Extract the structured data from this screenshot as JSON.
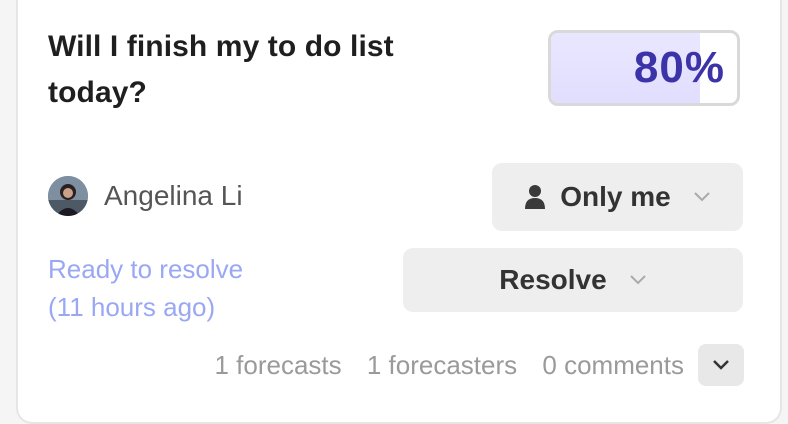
{
  "market": {
    "question": "Will I finish my to do list today?",
    "probability_label": "80%",
    "probability_fraction": 0.8
  },
  "author": {
    "name": "Angelina Li"
  },
  "visibility": {
    "label": "Only me"
  },
  "resolve": {
    "label": "Resolve"
  },
  "status": {
    "line1": "Ready to resolve",
    "line2": "(11 hours ago)"
  },
  "stats": {
    "forecasts": "1 forecasts",
    "forecasters": "1 forecasters",
    "comments": "0 comments"
  },
  "colors": {
    "accent": "#3c33a9",
    "fill": "#e4e2fe",
    "status": "#9aa8f4"
  },
  "icons": {
    "visibility": "user-icon",
    "dropdown": "chevron-down-icon",
    "expand": "chevron-down-icon"
  }
}
